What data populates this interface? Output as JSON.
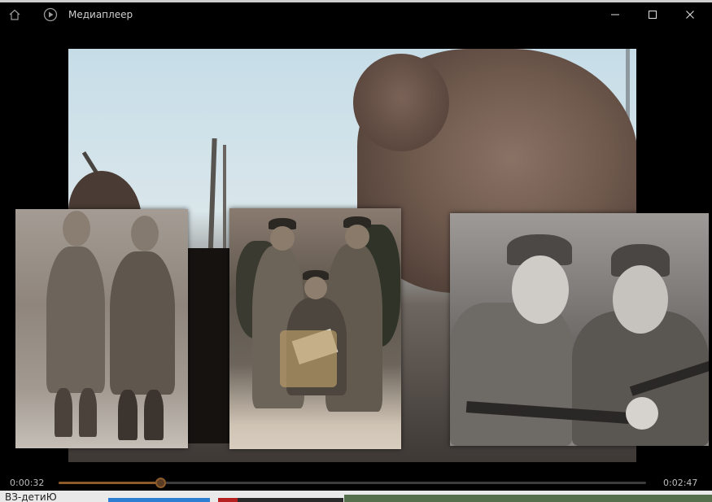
{
  "background": {
    "bottom_text": "ВЗ-детиЮ"
  },
  "titlebar": {
    "app_title": "Медиаплеер",
    "home_icon": "home-icon",
    "app_icon": "play-circle-icon",
    "minimize_icon": "minimize-icon",
    "maximize_icon": "maximize-icon",
    "close_icon": "close-icon"
  },
  "player": {
    "current_time": "0:00:32",
    "total_time": "0:02:47",
    "progress": 0.173,
    "accent_color": "#8d5a2a"
  }
}
